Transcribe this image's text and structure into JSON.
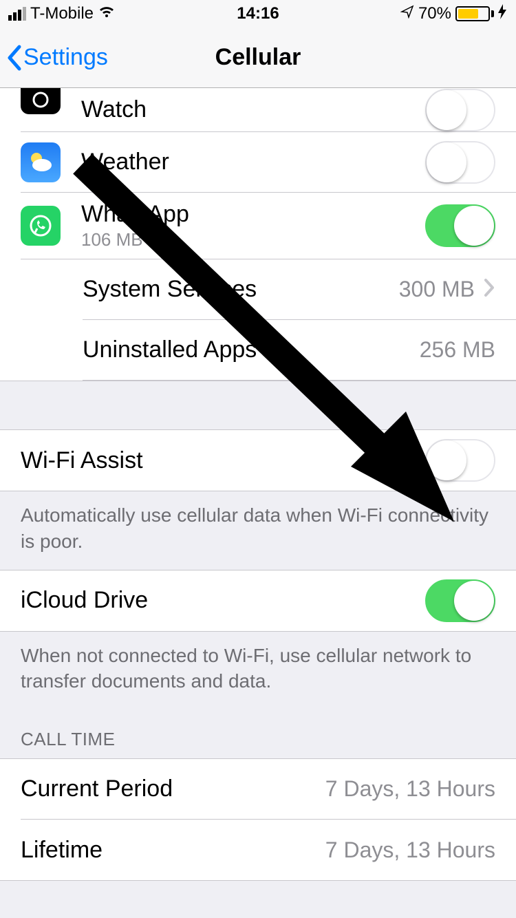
{
  "status": {
    "carrier": "T-Mobile",
    "time": "14:16",
    "battery_pct": "70%"
  },
  "nav": {
    "back_label": "Settings",
    "title": "Cellular"
  },
  "apps": {
    "watch": {
      "title": "Watch"
    },
    "weather": {
      "title": "Weather"
    },
    "whatsapp": {
      "title": "WhatsApp",
      "usage": "106 MB"
    },
    "system_services": {
      "title": "System Services",
      "usage": "300 MB"
    },
    "uninstalled": {
      "title": "Uninstalled Apps",
      "usage": "256 MB"
    }
  },
  "wifi_assist": {
    "title": "Wi-Fi Assist",
    "footer": "Automatically use cellular data when Wi-Fi connectivity is poor."
  },
  "icloud_drive": {
    "title": "iCloud Drive",
    "footer": "When not connected to Wi-Fi, use cellular network to transfer documents and data."
  },
  "call_time": {
    "header": "CALL TIME",
    "current_label": "Current Period",
    "current_value": "7 Days, 13 Hours",
    "lifetime_label": "Lifetime",
    "lifetime_value": "7 Days, 13 Hours"
  }
}
